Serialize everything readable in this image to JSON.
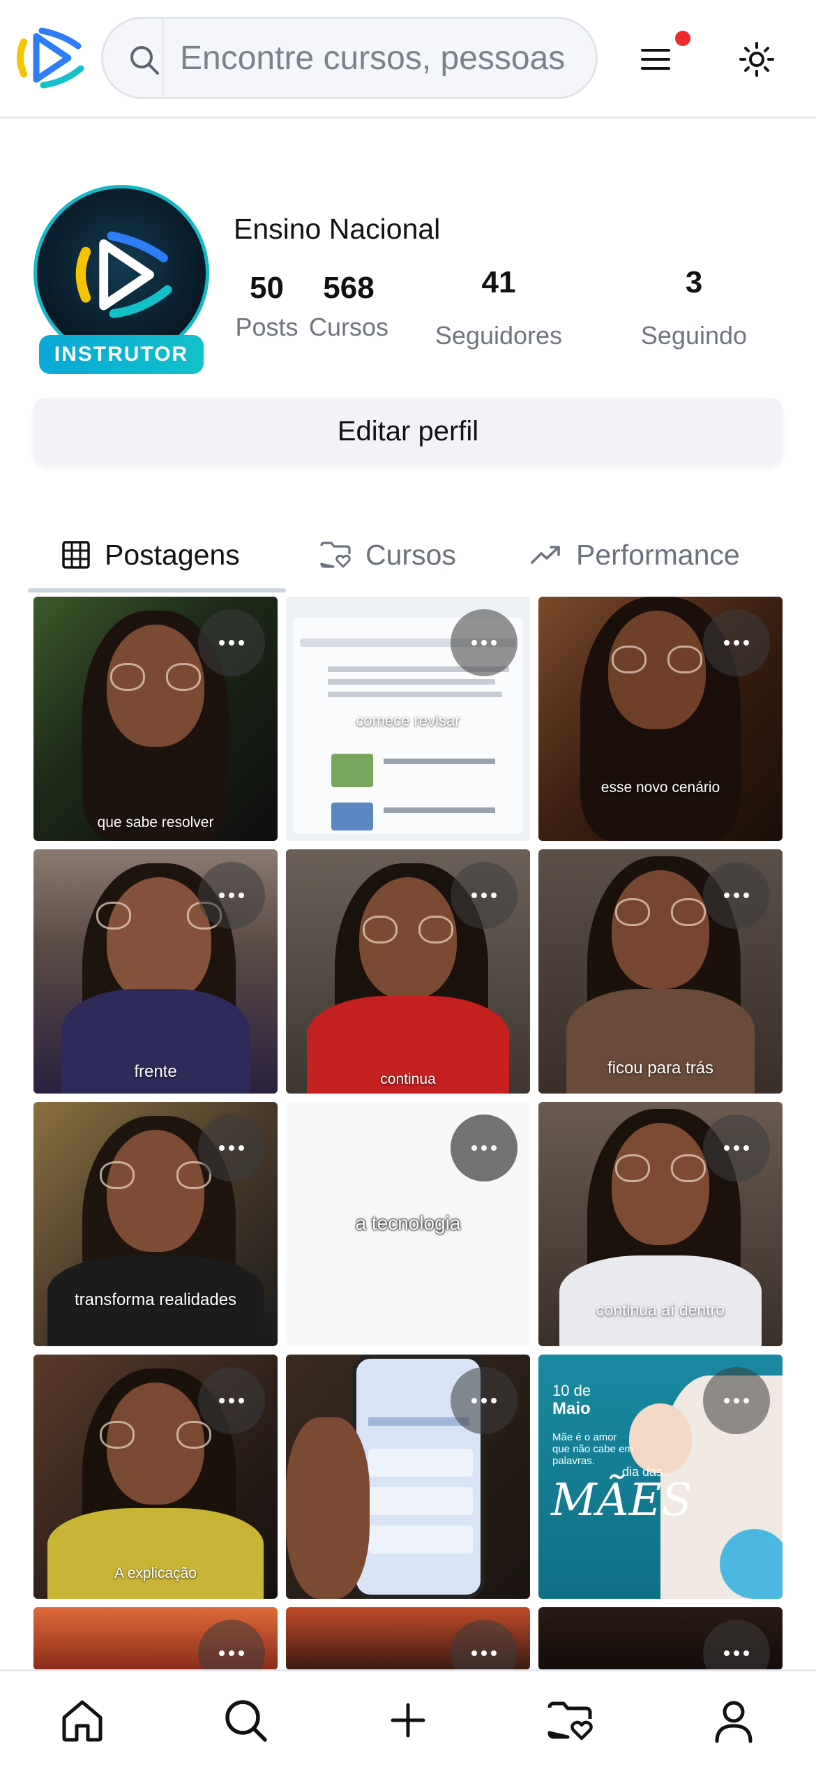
{
  "app": {
    "brand_colors": {
      "accent": "#13c1c9",
      "yellow": "#f5c400",
      "blue": "#2e7cf6",
      "notification": "#ee2b2b"
    }
  },
  "header": {
    "search_placeholder": "Encontre cursos, pessoas",
    "icons": [
      "search-icon",
      "menu-icon",
      "sun-icon"
    ]
  },
  "profile": {
    "name": "Ensino Nacional",
    "badge": "INSTRUTOR",
    "stats": [
      {
        "value": "50",
        "label": "Posts"
      },
      {
        "value": "568",
        "label": "Cursos"
      },
      {
        "value": "41",
        "label": "Seguidores"
      },
      {
        "value": "3",
        "label": "Seguindo"
      }
    ],
    "edit_label": "Editar perfil"
  },
  "tabs": [
    {
      "label": "Postagens",
      "icon": "grid-icon",
      "active": true
    },
    {
      "label": "Cursos",
      "icon": "folder-heart-icon",
      "active": false
    },
    {
      "label": "Performance",
      "icon": "trending-up-icon",
      "active": false
    }
  ],
  "posts": [
    {
      "caption": "que sabe resolver"
    },
    {
      "caption": "comece revisar"
    },
    {
      "caption": "esse novo cenário"
    },
    {
      "caption": "frente"
    },
    {
      "caption": "continua"
    },
    {
      "caption": "ficou para trás"
    },
    {
      "caption": "transforma realidades"
    },
    {
      "caption": "a tecnologia"
    },
    {
      "caption": "continua aí dentro"
    },
    {
      "caption": "A explicação"
    },
    {
      "caption": ""
    },
    {
      "caption": "",
      "title_small": "10 de",
      "title_month": "Maio",
      "tagline": "Mãe é o amor que não cabe em palavras.",
      "small_heading": "dia das",
      "big_heading": "MÃES"
    },
    {
      "caption": ""
    },
    {
      "caption": ""
    },
    {
      "caption": ""
    }
  ],
  "bottom_nav": [
    "home-icon",
    "search-icon",
    "plus-icon",
    "folder-heart-icon",
    "user-icon"
  ]
}
